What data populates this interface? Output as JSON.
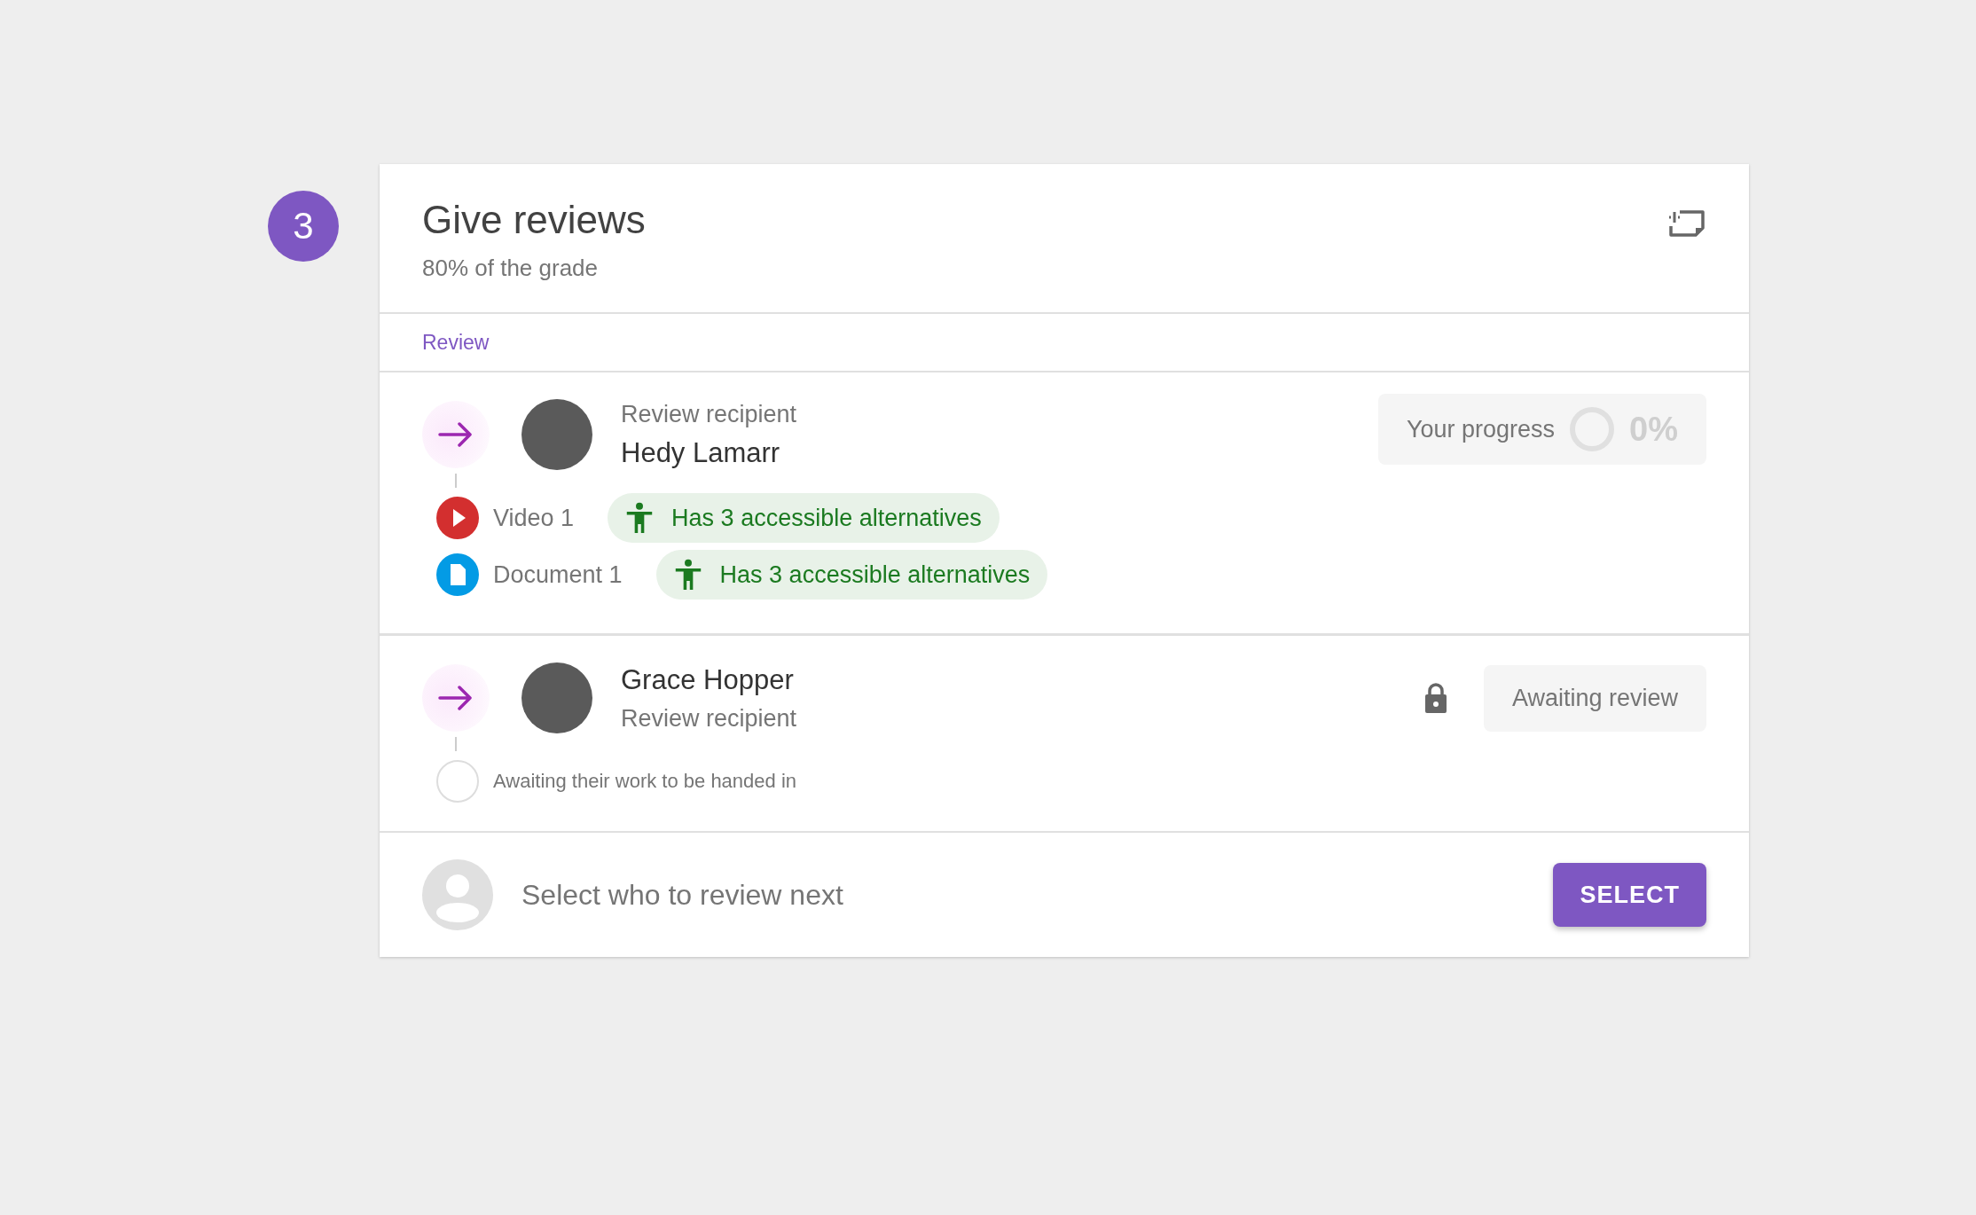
{
  "step": {
    "number": "3"
  },
  "header": {
    "title": "Give reviews",
    "subtitle": "80% of the grade"
  },
  "tabs": [
    {
      "label": "Review",
      "selected": true
    }
  ],
  "reviews": [
    {
      "kind": "in_progress",
      "role": "Review recipient",
      "name": "Hedy Lamarr",
      "progress": {
        "label": "Your progress",
        "reading": "0%",
        "level": 0
      },
      "attachments": [
        {
          "kind": "video",
          "label": "Video 1",
          "chip": "Has 3 accessible alternatives"
        },
        {
          "kind": "document",
          "label": "Document 1",
          "chip": "Has 3 accessible alternatives"
        }
      ]
    },
    {
      "kind": "awaiting",
      "role": "Review recipient",
      "name": "Grace Hopper",
      "locked": true,
      "status": "Awaiting review",
      "note": "Awaiting their work to be handed in"
    }
  ],
  "footer": {
    "prompt": "Select who to review next",
    "button": "SELECT"
  }
}
